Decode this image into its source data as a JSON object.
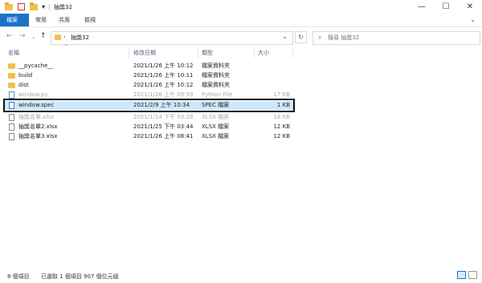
{
  "window": {
    "title": "抽獎32",
    "controls": {
      "minimize": "—",
      "maximize": "☐",
      "close": "✕"
    }
  },
  "ribbon": {
    "tabs": [
      "檔案",
      "常用",
      "共用",
      "檢視"
    ]
  },
  "address": {
    "path": "抽獎32",
    "search_placeholder": "搜尋 抽獎32"
  },
  "columns": {
    "name": "名稱",
    "date": "修改日期",
    "type": "類型",
    "size": "大小"
  },
  "files": [
    {
      "name": "__pycache__",
      "date": "2021/1/26 上午 10:12",
      "type": "檔案資料夾",
      "size": "",
      "kind": "folder"
    },
    {
      "name": "build",
      "date": "2021/1/26 上午 10:11",
      "type": "檔案資料夾",
      "size": "",
      "kind": "folder"
    },
    {
      "name": "dist",
      "date": "2021/1/26 上午 10:12",
      "type": "檔案資料夾",
      "size": "",
      "kind": "folder"
    },
    {
      "name": "window.py",
      "date": "2021/1/26 上午 09:59",
      "type": "Python File",
      "size": "17 KB",
      "kind": "file"
    },
    {
      "name": "window.spec",
      "date": "2021/2/9 上午 10:34",
      "type": "SPEC 檔案",
      "size": "1 KB",
      "kind": "file"
    },
    {
      "name": "抽獎名單.xlsx",
      "date": "2021/1/14 下午 03:28",
      "type": "XLSX 檔案",
      "size": "18 KB",
      "kind": "file"
    },
    {
      "name": "抽獎名單2.xlsx",
      "date": "2021/1/25 下午 03:44",
      "type": "XLSX 檔案",
      "size": "12 KB",
      "kind": "file"
    },
    {
      "name": "抽獎名單3.xlsx",
      "date": "2021/1/26 上午 08:41",
      "type": "XLSX 檔案",
      "size": "12 KB",
      "kind": "file"
    }
  ],
  "status": {
    "count": "8 個項目",
    "selection": "已選取 1 個項目  907 個位元組"
  },
  "colors": {
    "accent": "#1a73c9",
    "selection": "#cce8ff"
  }
}
